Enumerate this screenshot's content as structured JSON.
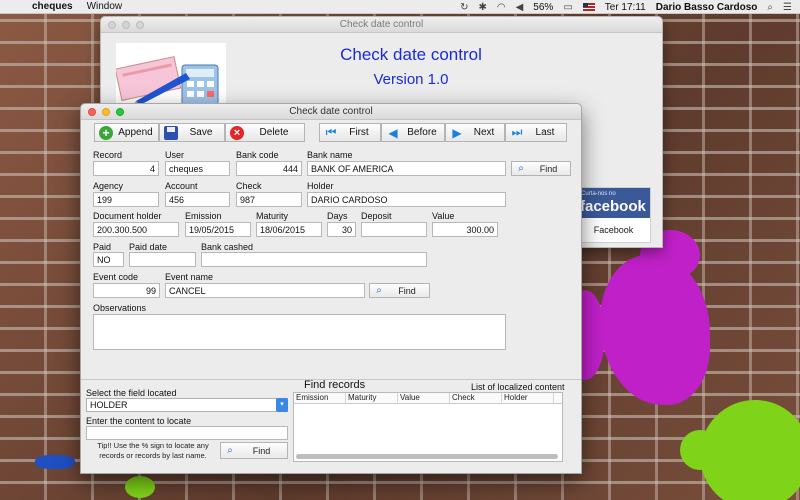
{
  "menubar": {
    "app_name": "cheques",
    "items": [
      "Window"
    ],
    "battery": "56%",
    "clock": "Ter 17:11",
    "user": "Dario Basso Cardoso"
  },
  "back_window": {
    "title": "Check date control",
    "heading": "Check date control",
    "version": "Version 1.0",
    "facebook_banner_small": "Curta-nos no",
    "facebook_banner_word": "facebook",
    "facebook_label": "Facebook"
  },
  "front_window": {
    "title": "Check date control",
    "toolbar": {
      "append": "Append",
      "save": "Save",
      "delete": "Delete",
      "first": "First",
      "before": "Before",
      "next": "Next",
      "last": "Last"
    },
    "labels": {
      "record": "Record",
      "user": "User",
      "bank_code": "Bank code",
      "bank_name": "Bank name",
      "agency": "Agency",
      "account": "Account",
      "check": "Check",
      "holder": "Holder",
      "document_holder": "Document holder",
      "emission": "Emission",
      "maturity": "Maturity",
      "days": "Days",
      "deposit": "Deposit",
      "value": "Value",
      "paid": "Paid",
      "paid_date": "Paid date",
      "bank_cashed": "Bank cashed",
      "event_code": "Event code",
      "event_name": "Event name",
      "observations": "Observations"
    },
    "values": {
      "record": "4",
      "user": "cheques",
      "bank_code": "444",
      "bank_name": "BANK OF AMERICA",
      "agency": "199",
      "account": "456",
      "check": "987",
      "holder": "DARIO CARDOSO",
      "document_holder": "200.300.500",
      "emission": "19/05/2015",
      "maturity": "18/06/2015",
      "days": "30",
      "deposit": "",
      "value": "300.00",
      "paid": "NO",
      "paid_date": "",
      "bank_cashed": "",
      "event_code": "99",
      "event_name": "CANCEL",
      "observations": ""
    },
    "find_label": "Find",
    "search_panel": {
      "select_label": "Select the field located",
      "select_value": "HOLDER",
      "content_label": "Enter the content to locate",
      "content_value": "",
      "tip": "Tip!! Use the % sign to locate any records or records by last name.",
      "find_button": "Find",
      "find_records_title": "Find records",
      "list_title": "List of localized content",
      "columns": [
        "Emission",
        "Maturity",
        "Value",
        "Check",
        "Holder"
      ]
    }
  }
}
